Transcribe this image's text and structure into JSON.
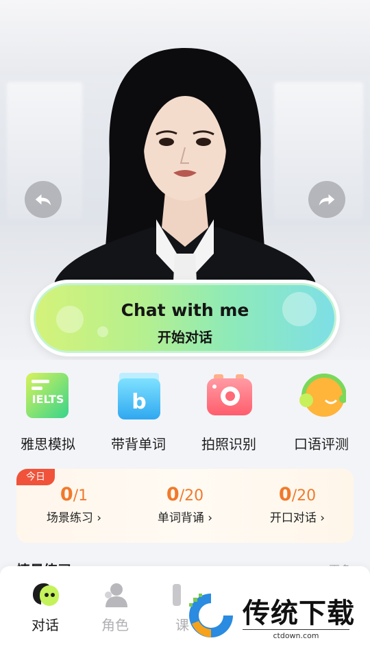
{
  "hero": {
    "chat_button": {
      "title_en": "Chat with me",
      "title_cn": "开始对话"
    }
  },
  "features": [
    {
      "label": "雅思模拟",
      "icon": "ielts-book-icon",
      "badge": "IELTS"
    },
    {
      "label": "带背单词",
      "icon": "word-book-icon",
      "badge": "b"
    },
    {
      "label": "拍照识别",
      "icon": "camera-icon"
    },
    {
      "label": "口语评测",
      "icon": "speaking-face-icon"
    }
  ],
  "today": {
    "tag": "今日",
    "stats": [
      {
        "done": "0",
        "total": "/1",
        "label": "场景练习"
      },
      {
        "done": "0",
        "total": "/20",
        "label": "单词背诵"
      },
      {
        "done": "0",
        "total": "/20",
        "label": "开口对话"
      }
    ]
  },
  "section": {
    "title": "情景练习",
    "more": "更多"
  },
  "nav": [
    {
      "label": "对话",
      "active": true
    },
    {
      "label": "角色",
      "active": false
    },
    {
      "label": "课",
      "active": false
    }
  ],
  "watermark": {
    "brand": "传统下载",
    "url": "ctdown.com"
  },
  "colors": {
    "accent": "#f07a2c",
    "tag": "#f0533a",
    "chat_gradient_start": "#d4f27a",
    "chat_gradient_end": "#7edfe6"
  }
}
